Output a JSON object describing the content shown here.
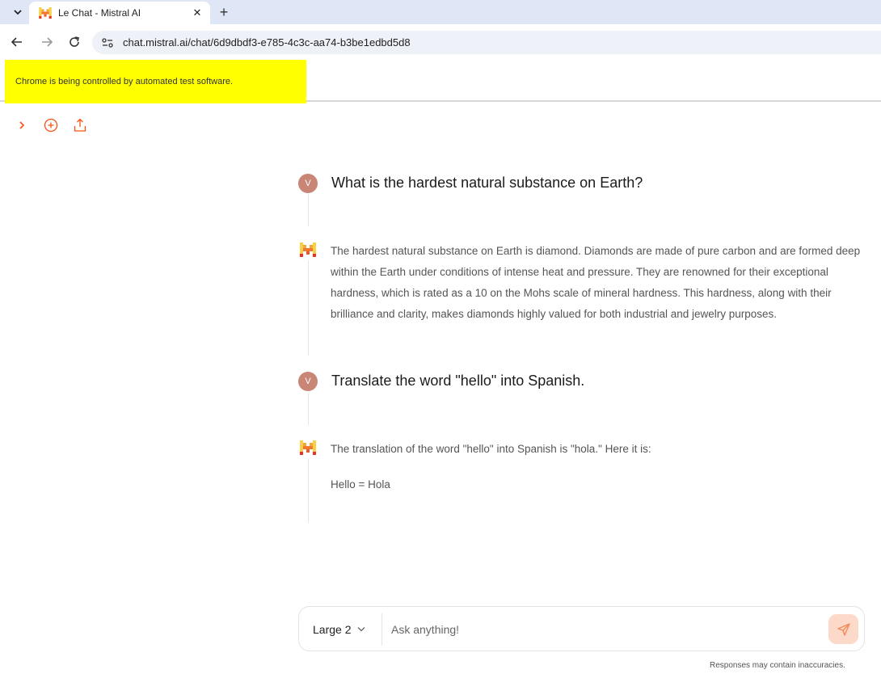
{
  "browser": {
    "tab_title": "Le Chat - Mistral AI",
    "tab_close": "✕",
    "new_tab": "+",
    "url": "chat.mistral.ai/chat/6d9dbdf3-e785-4c3c-aa74-b3be1edbd5d8",
    "automation_notice": "Chrome is being controlled by automated test software."
  },
  "conversation": [
    {
      "role": "user",
      "avatar": "V",
      "text": "What is the hardest natural substance on Earth?"
    },
    {
      "role": "assistant",
      "paragraphs": [
        "The hardest natural substance on Earth is diamond. Diamonds are made of pure carbon and are formed deep within the Earth under conditions of intense heat and pressure. They are renowned for their exceptional hardness, which is rated as a 10 on the Mohs scale of mineral hardness. This hardness, along with their brilliance and clarity, makes diamonds highly valued for both industrial and jewelry purposes."
      ]
    },
    {
      "role": "user",
      "avatar": "V",
      "text": "Translate the word \"hello\" into Spanish."
    },
    {
      "role": "assistant",
      "paragraphs": [
        "The translation of the word \"hello\" into Spanish is \"hola.\" Here it is:",
        "Hello = Hola"
      ]
    }
  ],
  "composer": {
    "model": "Large 2",
    "placeholder": "Ask anything!"
  },
  "disclaimer": "Responses may contain inaccuracies.",
  "colors": {
    "accent": "#fa500f",
    "avatar": "#c98676",
    "send_bg": "#fcd9c8",
    "automation_banner": "#ffff00"
  }
}
